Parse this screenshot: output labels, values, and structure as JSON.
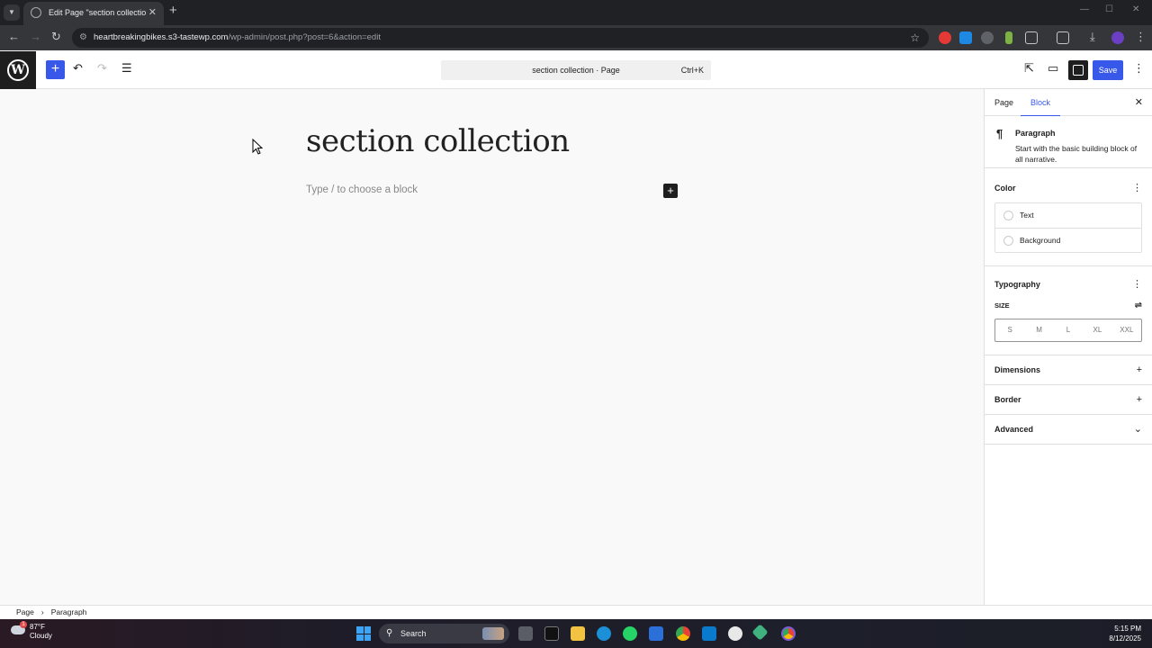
{
  "browser": {
    "tab_title": "Edit Page \"section collection\" ‹",
    "tab_close": "✕",
    "new_tab": "+",
    "url_host": "heartbreakingbikes.s3-tastewp.com",
    "url_path": "/wp-admin/post.php?post=6&action=edit"
  },
  "editor": {
    "command_label": "section collection · Page",
    "command_shortcut": "Ctrl+K",
    "save_label": "Save",
    "post_title": "section collection",
    "block_placeholder": "Type / to choose a block"
  },
  "sidebar": {
    "tab_page": "Page",
    "tab_block": "Block",
    "block_name": "Paragraph",
    "block_desc": "Start with the basic building block of all narrative.",
    "color_heading": "Color",
    "color_text": "Text",
    "color_background": "Background",
    "typography_heading": "Typography",
    "size_label": "SIZE",
    "sizes": [
      "S",
      "M",
      "L",
      "XL",
      "XXL"
    ],
    "dimensions_heading": "Dimensions",
    "border_heading": "Border",
    "advanced_heading": "Advanced"
  },
  "breadcrumbs": {
    "item1": "Page",
    "item2": "Paragraph"
  },
  "taskbar": {
    "temperature": "87°F",
    "condition": "Cloudy",
    "notification_count": "1",
    "search_label": "Search",
    "time": "5:15 PM",
    "date": "8/12/2025"
  },
  "colors": {
    "accent": "#3858e9",
    "dark": "#1e1e1e",
    "chrome_bg": "#202124"
  }
}
